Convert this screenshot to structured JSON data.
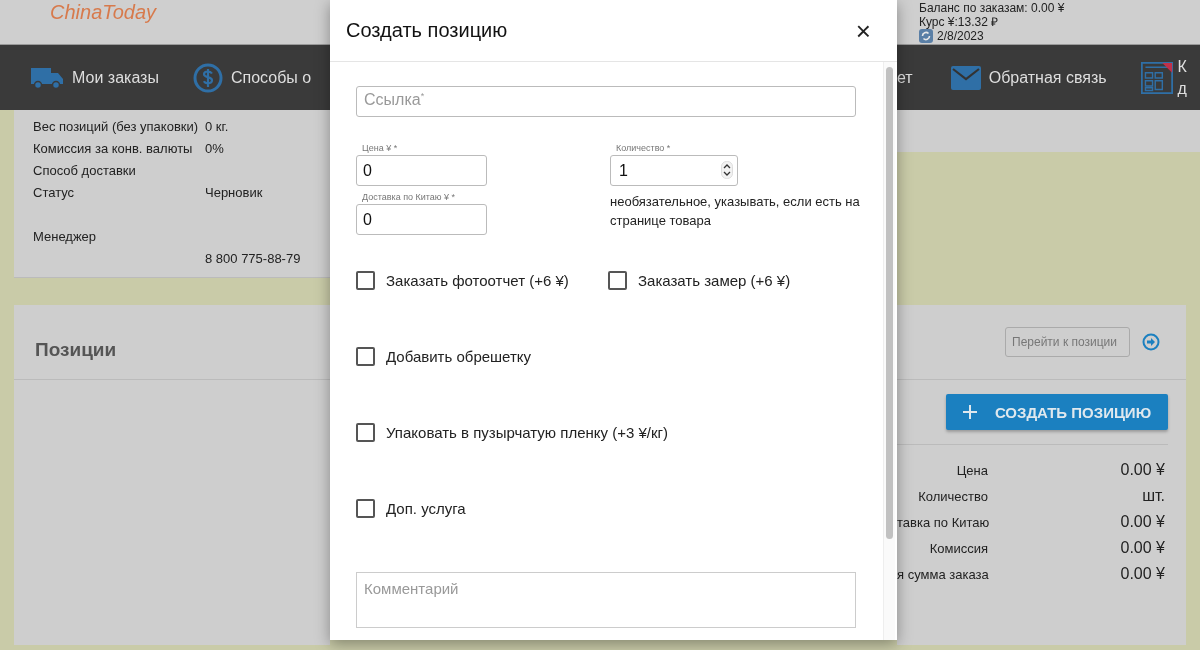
{
  "header": {
    "logo": "ChinaToday",
    "balance": "Баланс по заказам: 0.00 ¥",
    "rate": "Курс ¥:13.32 ₽",
    "date": "2/8/2023"
  },
  "nav_left": [
    {
      "kind": "truck",
      "label": "Мои заказы"
    },
    {
      "kind": "dollar",
      "label": "Способы о"
    }
  ],
  "nav_right": [
    {
      "kind": "none",
      "label": "ет"
    },
    {
      "kind": "mail",
      "label": "Обратная связь"
    },
    {
      "kind": "calculator",
      "label": "К",
      "label_2": "д"
    }
  ],
  "order_info": [
    {
      "label": "Вес позиций (без упаковки)",
      "value": "0 кг."
    },
    {
      "label": "Комиссия за конв. валюты",
      "value": "0%"
    },
    {
      "label": "Способ доставки"
    },
    {
      "label": "Статус",
      "value": "Черновик"
    },
    {
      "label": "Менеджер"
    },
    {
      "value": "8 800 775-88-79"
    }
  ],
  "positions": {
    "title": "Позиции",
    "goto_placeholder": "Перейти к позиции",
    "create_button": "СОЗДАТЬ ПОЗИЦИЮ",
    "totals": [
      {
        "label": "Цена",
        "value": "0.00 ¥"
      },
      {
        "label": "Количество",
        "value": "шт."
      },
      {
        "label": "тавка по Китаю",
        "value": "0.00 ¥"
      },
      {
        "label": "Комиссия",
        "value": "0.00 ¥"
      },
      {
        "label": "я сумма заказа",
        "value": "0.00 ¥"
      }
    ]
  },
  "dialog": {
    "title": "Создать позицию",
    "close": "×",
    "link_placeholder": "Ссылка$^{*}$",
    "price": {
      "label": "Цена ¥ *",
      "value": "0"
    },
    "delivery": {
      "label": "Доставка по Китаю ¥ *",
      "value": "0"
    },
    "quantity": {
      "label": "Количество *",
      "value": "1",
      "hint": "необязательное, указывать, если есть на странице товара"
    },
    "option_rows": [
      [
        {
          "label": "Заказать фотоотчет (+6 ¥)",
          "checked": false
        },
        {
          "label": "Заказать замер (+6 ¥)",
          "checked": false
        }
      ],
      [
        {
          "label": "Добавить обрешетку",
          "checked": false
        }
      ],
      [
        {
          "label": "Упаковать в пузырчатую пленку (+3 ¥/кг)",
          "checked": false
        }
      ],
      [
        {
          "label": "Доп. услуга",
          "checked": false
        }
      ]
    ],
    "comment_placeholder": "Комментарий"
  }
}
